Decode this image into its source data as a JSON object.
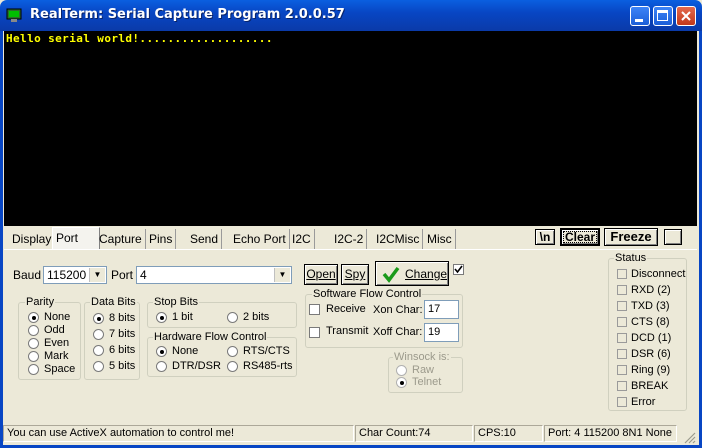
{
  "window": {
    "title": "RealTerm: Serial Capture Program 2.0.0.57",
    "controls": [
      "minimize",
      "maximize",
      "close"
    ]
  },
  "terminal": {
    "text": "Hello serial world!..................."
  },
  "tabs": [
    "Display",
    "Port",
    "Capture",
    "Pins",
    "Send",
    "Echo Port",
    "I2C",
    "I2C-2",
    "I2CMisc",
    "Misc"
  ],
  "active_tab": "Port",
  "top_buttons": {
    "newline": "\\n",
    "clear": "Clear",
    "freeze": "Freeze"
  },
  "port": {
    "baud_label": "Baud",
    "baud_value": "115200",
    "port_label": "Port",
    "port_value": "4",
    "open_label": "Open",
    "spy_label": "Spy",
    "change_label": "Change",
    "change_checked": true
  },
  "parity": {
    "title": "Parity",
    "options": [
      "None",
      "Odd",
      "Even",
      "Mark",
      "Space"
    ],
    "selected": "None"
  },
  "data_bits": {
    "title": "Data Bits",
    "options": [
      "8 bits",
      "7 bits",
      "6 bits",
      "5 bits"
    ],
    "selected": "8 bits"
  },
  "stop_bits": {
    "title": "Stop Bits",
    "options": [
      "1 bit",
      "2 bits"
    ],
    "selected": "1 bit"
  },
  "hw_flow": {
    "title": "Hardware Flow Control",
    "options": [
      "None",
      "RTS/CTS",
      "DTR/DSR",
      "RS485-rts"
    ],
    "selected": "None"
  },
  "sw_flow": {
    "title": "Software Flow Control",
    "receive_label": "Receive",
    "transmit_label": "Transmit",
    "xon_label": "Xon Char:",
    "xon_value": "17",
    "xoff_label": "Xoff Char:",
    "xoff_value": "19"
  },
  "winsock": {
    "title": "Winsock is:",
    "options": [
      "Raw",
      "Telnet"
    ],
    "selected": "Telnet"
  },
  "status": {
    "title": "Status",
    "items": [
      "Disconnect",
      "RXD (2)",
      "TXD (3)",
      "CTS (8)",
      "DCD (1)",
      "DSR (6)",
      "Ring (9)",
      "BREAK",
      "Error"
    ]
  },
  "statusbar": {
    "message": "You can use ActiveX automation to control me!",
    "char_count": "Char Count:74",
    "cps": "CPS:10",
    "port_info": "Port: 4 115200 8N1 None"
  },
  "colors": {
    "titlebar": "#0a5fe0",
    "terminal_bg": "#000000",
    "terminal_fg": "#ffff00",
    "face": "#ece9d8"
  }
}
